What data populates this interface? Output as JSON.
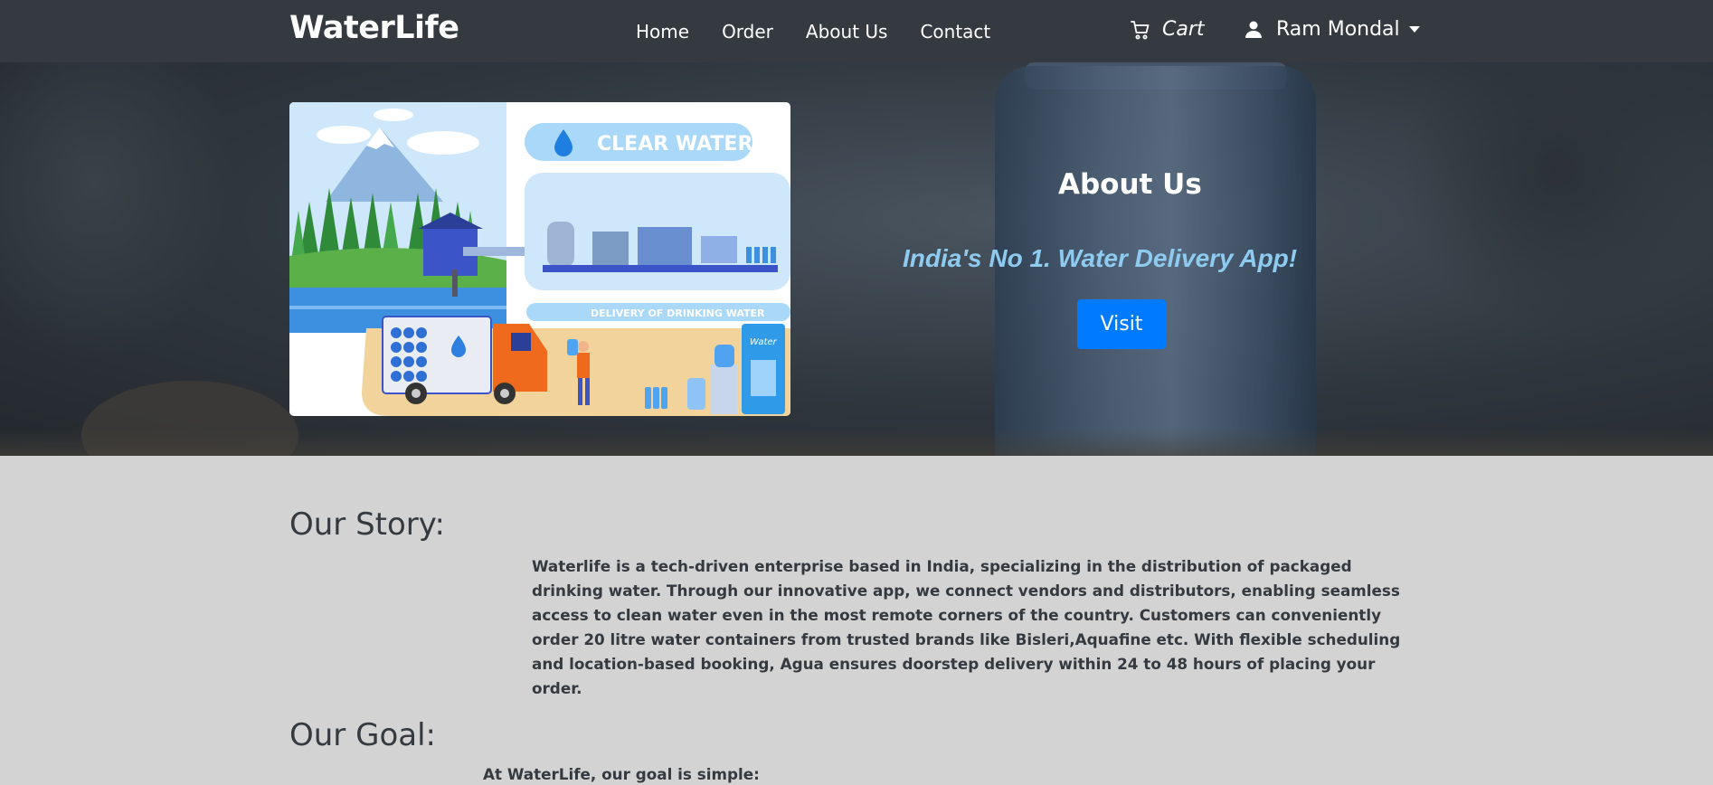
{
  "navbar": {
    "brand": "WaterLife",
    "links": [
      "Home",
      "Order",
      "About Us",
      "Contact"
    ],
    "cart_label": "Cart",
    "user_name": "Ram Mondal"
  },
  "hero": {
    "title": "About Us",
    "tagline": "India's No 1. Water Delivery App!",
    "visit_label": "Visit",
    "image_text": {
      "clear_water": "CLEAR WATER",
      "delivery": "DELIVERY OF DRINKING WATER",
      "truck_label": "water",
      "cooler_label": "Water"
    }
  },
  "content": {
    "story_heading": "Our Story:",
    "story_text": "Waterlife is a tech-driven enterprise based in India, specializing in the distribution of packaged drinking water. Through our innovative app, we connect vendors and distributors, enabling seamless access to clean water even in the most remote corners of the country. Customers can conveniently order 20 litre water containers from trusted brands like Bisleri,Aquafine etc. With flexible scheduling and location-based booking, Agua ensures doorstep delivery within 24 to 48 hours of placing your order.",
    "goal_heading": "Our Goal:",
    "goal_text": "At WaterLife, our goal is simple:"
  },
  "colors": {
    "navbar_bg": "#343a40",
    "accent": "#007bff",
    "tagline": "#8ecbf0",
    "page_bg": "#d3d3d3"
  },
  "icons": [
    "cart-icon",
    "user-icon",
    "caret-down-icon"
  ]
}
